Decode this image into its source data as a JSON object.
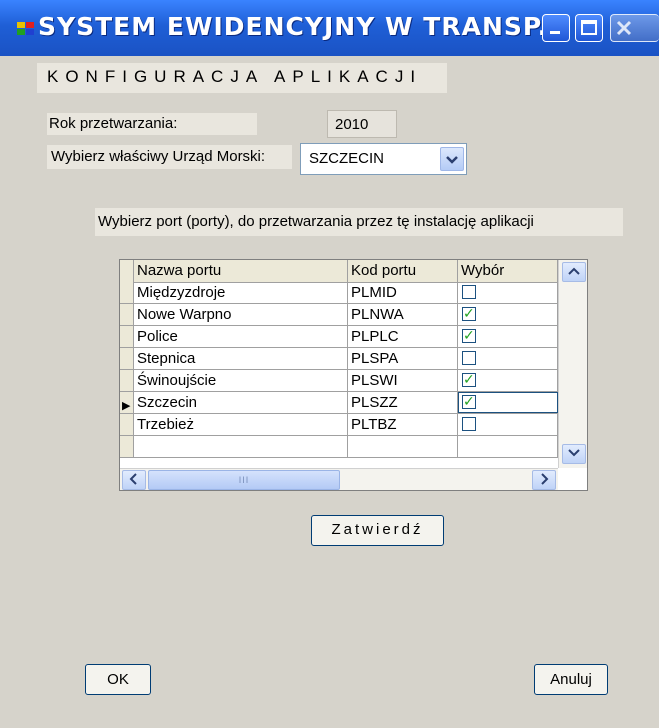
{
  "window": {
    "title": "SYSTEM EWIDENCYJNY W TRANSP...",
    "icon": "app-icon"
  },
  "header": {
    "text": "KONFIGURACJA APLIKACJI"
  },
  "year": {
    "label": "Rok przetwarzania:",
    "value": "2010"
  },
  "urzad": {
    "label": "Wybierz właściwy Urząd Morski:",
    "selected": "SZCZECIN"
  },
  "ports": {
    "instruction": "Wybierz port (porty), do przetwarzania przez tę instalację aplikacji",
    "columns": [
      "Nazwa portu",
      "Kod portu",
      "Wybór"
    ],
    "rows": [
      {
        "name": "Międzyzdroje",
        "code": "PLMID",
        "selected": false
      },
      {
        "name": "Nowe Warpno",
        "code": "PLNWA",
        "selected": true
      },
      {
        "name": "Police",
        "code": "PLPLC",
        "selected": true
      },
      {
        "name": "Stepnica",
        "code": "PLSPA",
        "selected": false
      },
      {
        "name": "Świnoujście",
        "code": "PLSWI",
        "selected": true
      },
      {
        "name": "Szczecin",
        "code": "PLSZZ",
        "selected": true
      },
      {
        "name": "Trzebież",
        "code": "PLTBZ",
        "selected": false
      },
      {
        "name": "",
        "code": "",
        "selected": null
      }
    ],
    "current_row": 5,
    "scrollbar_thumb_text": "III"
  },
  "buttons": {
    "confirm": "Zatwierdź",
    "ok": "OK",
    "cancel": "Anuluj"
  },
  "colors": {
    "titlebar": "#1f5fd6",
    "check": "#21a121",
    "background": "#d6d3cb"
  }
}
